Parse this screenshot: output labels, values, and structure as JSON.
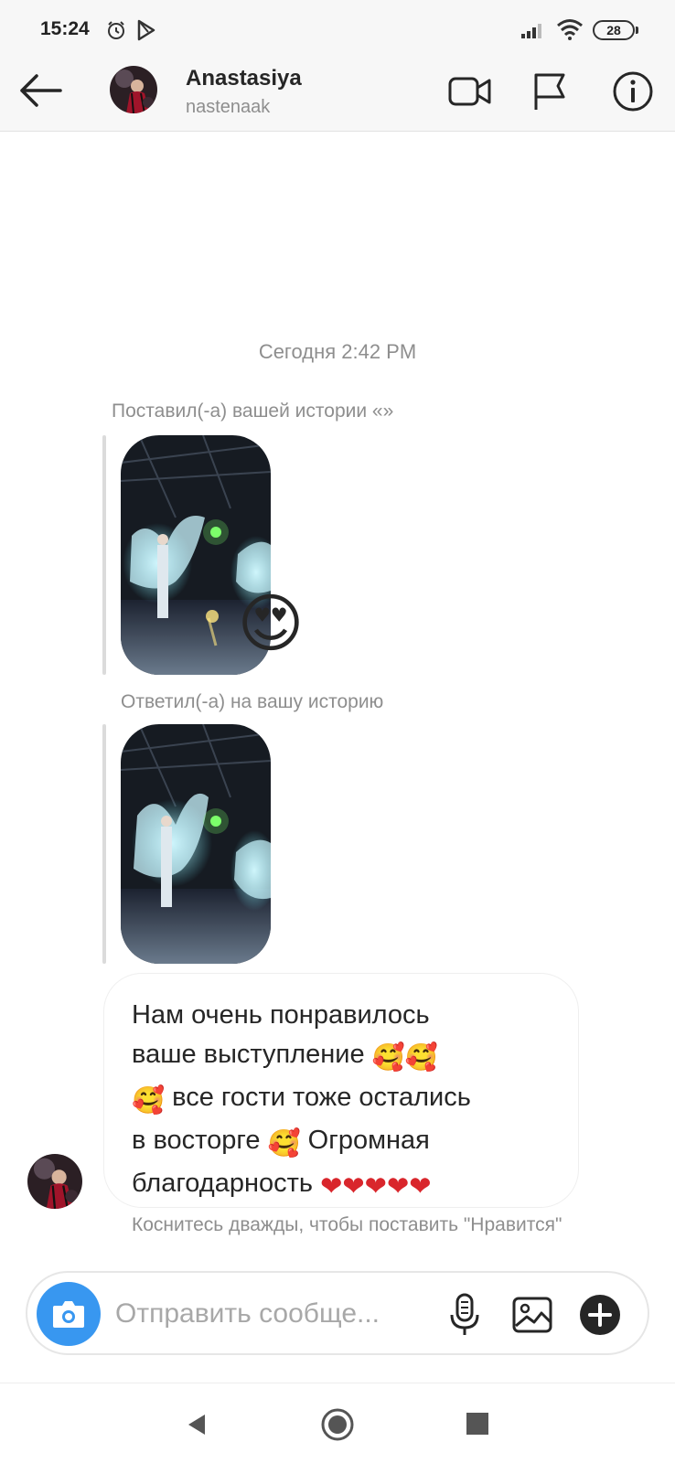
{
  "status_bar": {
    "time": "15:24",
    "battery": "28",
    "icons": [
      "alarm-icon",
      "play-store-icon",
      "signal-icon",
      "wifi-icon",
      "battery-icon"
    ]
  },
  "header": {
    "name": "Anastasiya",
    "username": "nastenaak",
    "icons": [
      "back-arrow-icon",
      "video-call-icon",
      "flag-icon",
      "info-icon"
    ]
  },
  "conversation": {
    "timestamp": "Сегодня 2:42 PM",
    "story_reaction_caption": "Поставил(-а) вашей истории «»",
    "reaction_emoji": "😍",
    "story_reply_caption": "Ответил(-а) на вашу историю",
    "message": {
      "line1": "Нам очень понравилось",
      "line2_text": "ваше выступление ",
      "line2_emoji": "🥰🥰",
      "line3_emoji": "🥰",
      "line3_text": " все гости тоже остались",
      "line4_text": "в восторге ",
      "line4_emoji": "🥰",
      "line4_text2": " Огромная",
      "line5_text": "благодарность ",
      "line5_emoji": "❤❤❤❤❤"
    },
    "like_hint": "Коснитесь дважды, чтобы поставить \"Нравится\""
  },
  "composer": {
    "placeholder": "Отправить сообще...",
    "icons": [
      "camera-icon",
      "microphone-icon",
      "gallery-icon",
      "plus-icon"
    ]
  },
  "colors": {
    "accent_blue": "#3897f0",
    "secondary_text": "#8e8e8e",
    "heart_red": "#d9262c"
  }
}
